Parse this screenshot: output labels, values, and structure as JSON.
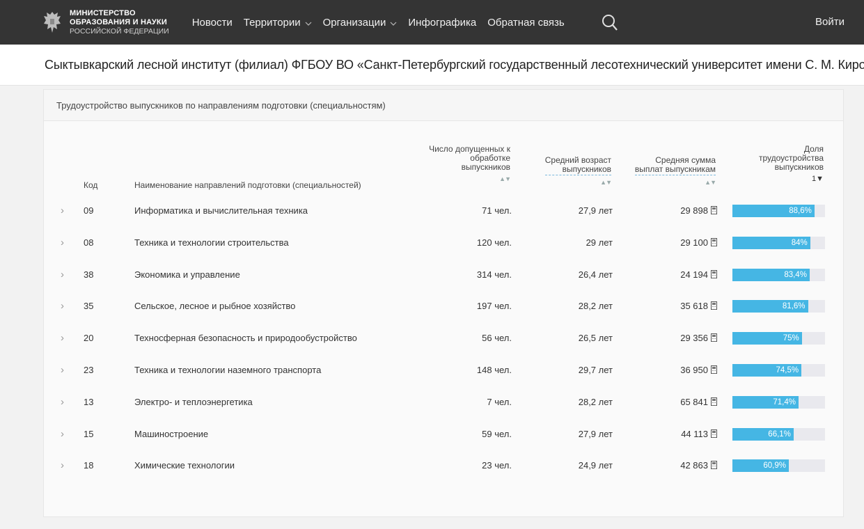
{
  "header": {
    "logo_line1": "МИНИСТЕРСТВО",
    "logo_line2": "ОБРАЗОВАНИЯ И НАУКИ",
    "logo_line3": "РОССИЙСКОЙ ФЕДЕРАЦИИ",
    "nav": [
      "Новости",
      "Территории",
      "Организации",
      "Инфографика",
      "Обратная связь"
    ],
    "login_label": "Войти"
  },
  "institution": {
    "title": "Сыктывкарский лесной институт (филиал) ФГБОУ ВО «Санкт-Петербургский государственный лесотехнический университет имени С. М. Кирова»"
  },
  "card": {
    "title": "Трудоустройство выпускников по направлениям подготовки (специальностям)"
  },
  "table": {
    "headers": {
      "code": "Код",
      "name": "Наименование направлений подготовки (специальностей)",
      "count_l1": "Число допущенных к",
      "count_l2": "обработке",
      "count_l3": "выпускников",
      "age_l1": "Средний возраст",
      "age_l2": "выпускников",
      "pay_l1": "Средняя сумма",
      "pay_l2": "выплат выпускникам",
      "share_l1": "Доля",
      "share_l2": "трудоустройства",
      "share_l3": "выпускников",
      "share_sort": "1▼"
    },
    "rows": [
      {
        "code": "09",
        "name": "Информатика и вычислительная техника",
        "count": "71 чел.",
        "age": "27,9 лет",
        "pay": "29 898",
        "share": 88.6,
        "share_label": "88,6%"
      },
      {
        "code": "08",
        "name": "Техника и технологии строительства",
        "count": "120 чел.",
        "age": "29 лет",
        "pay": "29 100",
        "share": 84,
        "share_label": "84%"
      },
      {
        "code": "38",
        "name": "Экономика и управление",
        "count": "314 чел.",
        "age": "26,4 лет",
        "pay": "24 194",
        "share": 83.4,
        "share_label": "83,4%"
      },
      {
        "code": "35",
        "name": "Сельское, лесное и рыбное хозяйство",
        "count": "197 чел.",
        "age": "28,2 лет",
        "pay": "35 618",
        "share": 81.6,
        "share_label": "81,6%"
      },
      {
        "code": "20",
        "name": "Техносферная безопасность и природообустройство",
        "count": "56 чел.",
        "age": "26,5 лет",
        "pay": "29 356",
        "share": 75,
        "share_label": "75%"
      },
      {
        "code": "23",
        "name": "Техника и технологии наземного транспорта",
        "count": "148 чел.",
        "age": "29,7 лет",
        "pay": "36 950",
        "share": 74.5,
        "share_label": "74,5%"
      },
      {
        "code": "13",
        "name": "Электро- и теплоэнергетика",
        "count": "7 чел.",
        "age": "28,2 лет",
        "pay": "65 841",
        "share": 71.4,
        "share_label": "71,4%"
      },
      {
        "code": "15",
        "name": "Машиностроение",
        "count": "59 чел.",
        "age": "27,9 лет",
        "pay": "44 113",
        "share": 66.1,
        "share_label": "66,1%"
      },
      {
        "code": "18",
        "name": "Химические технологии",
        "count": "23 чел.",
        "age": "24,9 лет",
        "pay": "42 863",
        "share": 60.9,
        "share_label": "60,9%"
      }
    ]
  },
  "colors": {
    "topbar": "#343434",
    "bar_fill": "#45b6e4",
    "bar_track": "#e9e9ee"
  }
}
